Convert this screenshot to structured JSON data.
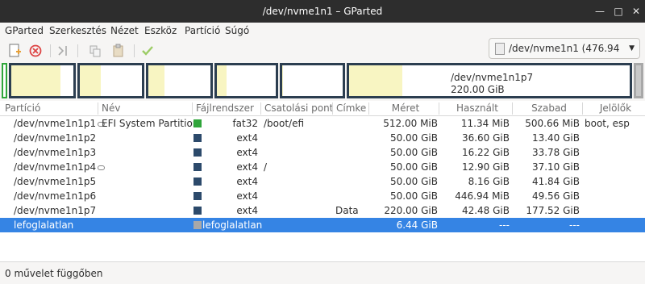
{
  "window": {
    "title": "/dev/nvme1n1 – GParted"
  },
  "menu": [
    "GParted",
    "Szerkesztés",
    "Nézet",
    "Eszköz",
    "Partíció",
    "Súgó"
  ],
  "toolbar": {
    "icons": [
      "new-partition-icon",
      "delete-icon",
      "resize-move-icon",
      "copy-icon",
      "paste-icon",
      "apply-icon"
    ]
  },
  "device_selector": {
    "label": "/dev/nvme1n1 (476.94 GiB)"
  },
  "partition_map": {
    "selected_label": "/dev/nvme1n1p7",
    "selected_size": "220.00 GiB"
  },
  "columns": [
    "Partíció",
    "Név",
    "Fájlrendszer",
    "Csatolási pont",
    "Címke",
    "Méret",
    "Használt",
    "Szabad",
    "Jelölők"
  ],
  "partitions": [
    {
      "partition": "/dev/nvme1n1p1",
      "key": true,
      "name": "EFI System Partition",
      "fs": "fat32",
      "fs_color": "#2fa53a",
      "mount": "/boot/efi",
      "label": "",
      "size": "512.00 MiB",
      "used": "11.34 MiB",
      "free": "500.66 MiB",
      "flags": "boot, esp"
    },
    {
      "partition": "/dev/nvme1n1p2",
      "key": false,
      "name": "",
      "fs": "ext4",
      "fs_color": "#2c4a6b",
      "mount": "",
      "label": "",
      "size": "50.00 GiB",
      "used": "36.60 GiB",
      "free": "13.40 GiB",
      "flags": ""
    },
    {
      "partition": "/dev/nvme1n1p3",
      "key": false,
      "name": "",
      "fs": "ext4",
      "fs_color": "#2c4a6b",
      "mount": "",
      "label": "",
      "size": "50.00 GiB",
      "used": "16.22 GiB",
      "free": "33.78 GiB",
      "flags": ""
    },
    {
      "partition": "/dev/nvme1n1p4",
      "key": true,
      "name": "",
      "fs": "ext4",
      "fs_color": "#2c4a6b",
      "mount": "/",
      "label": "",
      "size": "50.00 GiB",
      "used": "12.90 GiB",
      "free": "37.10 GiB",
      "flags": ""
    },
    {
      "partition": "/dev/nvme1n1p5",
      "key": false,
      "name": "",
      "fs": "ext4",
      "fs_color": "#2c4a6b",
      "mount": "",
      "label": "",
      "size": "50.00 GiB",
      "used": "8.16 GiB",
      "free": "41.84 GiB",
      "flags": ""
    },
    {
      "partition": "/dev/nvme1n1p6",
      "key": false,
      "name": "",
      "fs": "ext4",
      "fs_color": "#2c4a6b",
      "mount": "",
      "label": "",
      "size": "50.00 GiB",
      "used": "446.94 MiB",
      "free": "49.56 GiB",
      "flags": ""
    },
    {
      "partition": "/dev/nvme1n1p7",
      "key": false,
      "name": "",
      "fs": "ext4",
      "fs_color": "#2c4a6b",
      "mount": "",
      "label": "Data",
      "size": "220.00 GiB",
      "used": "42.48 GiB",
      "free": "177.52 GiB",
      "flags": ""
    },
    {
      "partition": "lefoglalatlan",
      "key": false,
      "name": "",
      "fs": "lefoglalatlan",
      "fs_color": "#a8a8a8",
      "mount": "",
      "label": "",
      "size": "6.44 GiB",
      "used": "---",
      "free": "---",
      "flags": "",
      "selected": true
    }
  ],
  "status": {
    "text": "0 művelet függőben"
  },
  "colors": {
    "selection": "#3584e4",
    "used_space": "#f8f5c2",
    "ext4": "#2c4a6b",
    "fat32": "#2fa53a"
  }
}
